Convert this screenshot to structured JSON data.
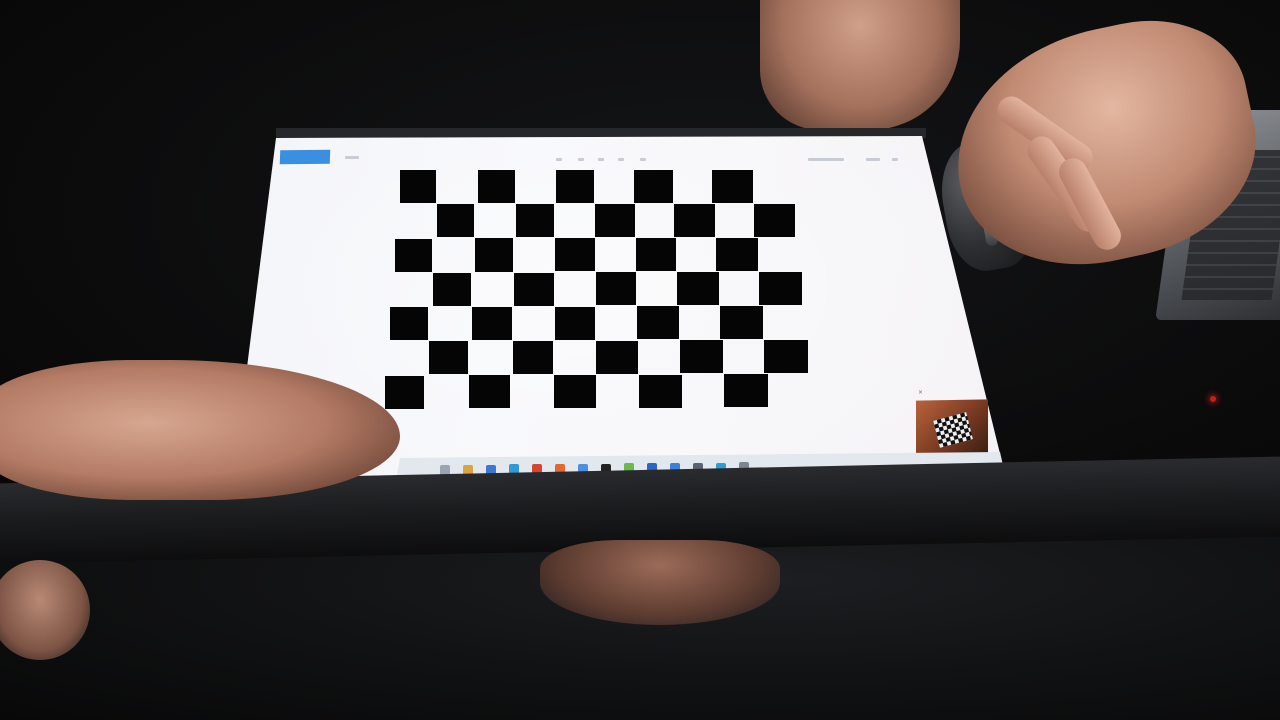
{
  "photo": {
    "subject": "",
    "screen": {
      "app_badge_label": "",
      "checkerboard": {
        "rows": 7,
        "cols": 10
      },
      "taskbar_icon_count": 14
    }
  },
  "colors": {
    "screen_bg": "#f3f5f9",
    "checker_dark": "#050505",
    "app_accent": "#3b8fe0",
    "skin": "#c18a72",
    "monitor_frame": "#1b1c1e"
  }
}
